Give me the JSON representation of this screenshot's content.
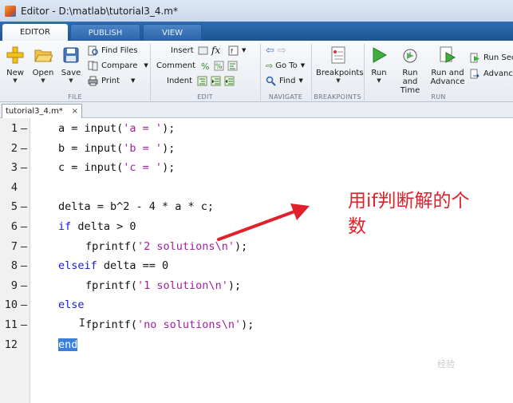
{
  "window": {
    "title": "Editor - D:\\matlab\\tutorial3_4.m*"
  },
  "tabs": [
    {
      "label": "EDITOR",
      "active": true
    },
    {
      "label": "PUBLISH",
      "active": false
    },
    {
      "label": "VIEW",
      "active": false
    }
  ],
  "ribbon": {
    "groups": {
      "file": "FILE",
      "edit": "EDIT",
      "navigate": "NAVIGATE",
      "breakpoints": "BREAKPOINTS",
      "run": "RUN"
    },
    "file": {
      "new": "New",
      "open": "Open",
      "save": "Save",
      "find_files": "Find Files",
      "compare": "Compare",
      "print": "Print"
    },
    "edit": {
      "insert": "Insert",
      "comment": "Comment",
      "indent": "Indent",
      "fx": "fx"
    },
    "navigate": {
      "go_to": "Go To",
      "find": "Find"
    },
    "breakpoints": {
      "label": "Breakpoints"
    },
    "run": {
      "run": "Run",
      "run_and_time_1": "Run and",
      "run_and_time_2": "Time",
      "run_and_advance_1": "Run and",
      "run_and_advance_2": "Advance",
      "run_section": "Run Secti",
      "advance": "Advance"
    }
  },
  "file_tab": {
    "label": "tutorial3_4.m*",
    "close": "×"
  },
  "editor": {
    "lines": [
      {
        "n": "1",
        "dash": "—",
        "segments": [
          {
            "t": "a = input(",
            "c": ""
          },
          {
            "t": "'a = '",
            "c": "str"
          },
          {
            "t": ");",
            "c": ""
          }
        ]
      },
      {
        "n": "2",
        "dash": "—",
        "segments": [
          {
            "t": "b = input(",
            "c": ""
          },
          {
            "t": "'b = '",
            "c": "str"
          },
          {
            "t": ");",
            "c": ""
          }
        ]
      },
      {
        "n": "3",
        "dash": "—",
        "segments": [
          {
            "t": "c = input(",
            "c": ""
          },
          {
            "t": "'c = '",
            "c": "str"
          },
          {
            "t": ");",
            "c": ""
          }
        ]
      },
      {
        "n": "4",
        "dash": "",
        "segments": []
      },
      {
        "n": "5",
        "dash": "—",
        "segments": [
          {
            "t": "delta = b^2 - 4 * a * c;",
            "c": ""
          }
        ]
      },
      {
        "n": "6",
        "dash": "—",
        "segments": [
          {
            "t": "if",
            "c": "kw"
          },
          {
            "t": " delta > 0",
            "c": ""
          }
        ]
      },
      {
        "n": "7",
        "dash": "—",
        "indent": 1,
        "segments": [
          {
            "t": "fprintf(",
            "c": ""
          },
          {
            "t": "'2 solutions\\n'",
            "c": "str"
          },
          {
            "t": ");",
            "c": ""
          }
        ]
      },
      {
        "n": "8",
        "dash": "—",
        "segments": [
          {
            "t": "elseif",
            "c": "kw"
          },
          {
            "t": " delta == 0",
            "c": ""
          }
        ]
      },
      {
        "n": "9",
        "dash": "—",
        "indent": 1,
        "segments": [
          {
            "t": "fprintf(",
            "c": ""
          },
          {
            "t": "'1 solution\\n'",
            "c": "str"
          },
          {
            "t": ");",
            "c": ""
          }
        ]
      },
      {
        "n": "10",
        "dash": "—",
        "segments": [
          {
            "t": "else",
            "c": "kw"
          }
        ]
      },
      {
        "n": "11",
        "dash": "—",
        "indent": 1,
        "segments": [
          {
            "t": "fprintf(",
            "c": ""
          },
          {
            "t": "'no solutions\\n'",
            "c": "str"
          },
          {
            "t": ");",
            "c": ""
          }
        ]
      },
      {
        "n": "12",
        "dash": "",
        "segments": [
          {
            "t": "end",
            "c": "kw sel"
          }
        ]
      }
    ]
  },
  "annotation": {
    "line1": "用if判断解的个",
    "line2": "数"
  },
  "watermark": "经验"
}
